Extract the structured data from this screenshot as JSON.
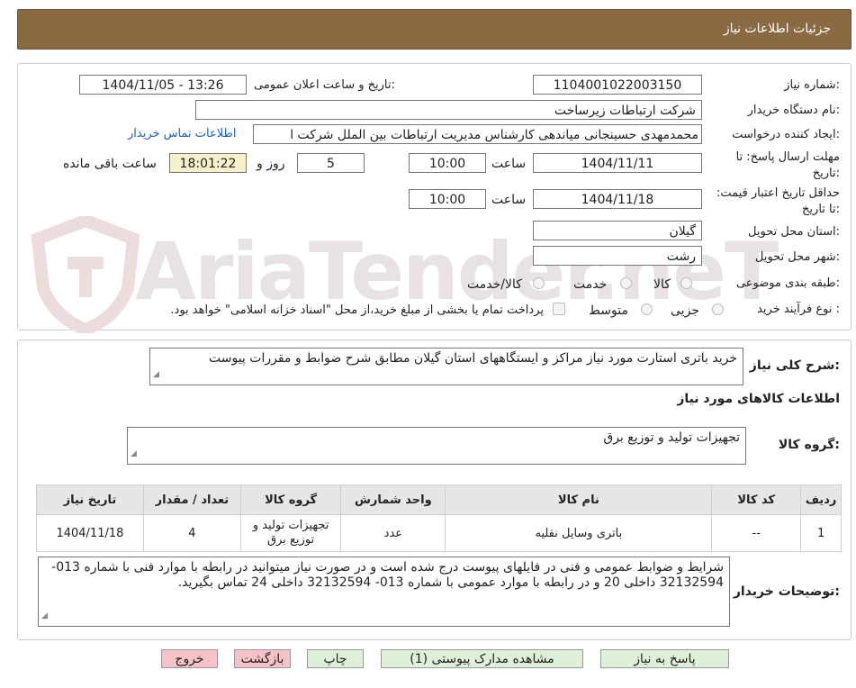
{
  "header": {
    "title": "جزئیات اطلاعات نیاز"
  },
  "watermark": {
    "text": "AriaTender.neT"
  },
  "fields": {
    "need_number_label": "شماره نیاز:",
    "need_number": "1104001022003150",
    "announce_label": "تاریخ و ساعت اعلان عمومی:",
    "announce_value": "1404/11/05 - 13:26",
    "buyer_org_label": "نام دستگاه خریدار:",
    "buyer_org": "شرکت ارتباطات زیرساخت",
    "requester_label": "ایجاد کننده درخواست:",
    "requester": "محمدمهدی حسینجانی میاندهی کارشناس مدیریت ارتباطات بین الملل شرکت ا",
    "contact_link": "اطلاعات تماس خریدار",
    "deadline_label": "مهلت ارسال پاسخ: تا تاریخ:",
    "deadline_date": "1404/11/11",
    "time_label": "ساعت",
    "deadline_time": "10:00",
    "days_value": "5",
    "days_label": "روز و",
    "remaining_time": "18:01:22",
    "remaining_label": "ساعت باقی مانده",
    "validity_label": "حداقل تاریخ اعتبار قیمت: تا تاریخ:",
    "validity_date": "1404/11/18",
    "validity_time": "10:00",
    "province_label": "استان محل تحویل:",
    "province": "گیلان",
    "city_label": "شهر محل تحویل:",
    "city": "رشت",
    "category_label": "طبقه بندی موضوعی:",
    "category_options": [
      "کالا",
      "خدمت",
      "کالا/خدمت"
    ],
    "process_label": "نوع فرآیند خرید :",
    "process_options": [
      "جزیی",
      "متوسط"
    ],
    "payment_note": "پرداخت تمام یا بخشی از مبلغ خرید،از محل \"اسناد خزانه اسلامی\" خواهد بود."
  },
  "summary": {
    "label": "شرح کلی نیاز:",
    "text": "خرید باتری استارت مورد نیاز مراکز و  ایستگاههای استان گیلان مطابق شرح ضوابط و مقررات پیوست"
  },
  "goods": {
    "section_title": "اطلاعات کالاهای مورد نیاز",
    "group_label": "گروه کالا:",
    "group_value": "تجهیزات تولید و توزیع برق",
    "table": {
      "headers": [
        "ردیف",
        "کد کالا",
        "نام کالا",
        "واحد شمارش",
        "گروه کالا",
        "تعداد / مقدار",
        "تاریخ نیاز"
      ],
      "rows": [
        [
          "1",
          "--",
          "باتری وسایل نقلیه",
          "عدد",
          "تجهیزات تولید و توزیع برق",
          "4",
          "1404/11/18"
        ]
      ]
    }
  },
  "buyer_notes": {
    "label": "توضیحات خریدار:",
    "text": "شرایط و ضوابط عمومی و فنی در فایلهای پیوست درج شده است و در صورت نیاز میتوانید در رابطه با موارد فنی با شماره 013- 32132594 داخلی 20 و در رابطه با موارد عمومی با شماره 013- 32132594 داخلی 24 تماس  بگیرید."
  },
  "buttons": {
    "reply": "پاسخ به نیاز",
    "attachments": "مشاهده مدارک پیوستی (1)",
    "print": "چاپ",
    "back": "بازگشت",
    "exit": "خروج"
  },
  "colors": {
    "header_bg": "#8a6a43",
    "link": "#1a5fcf",
    "button_green": "#dff0d8",
    "button_pink": "#f4c2c8"
  }
}
